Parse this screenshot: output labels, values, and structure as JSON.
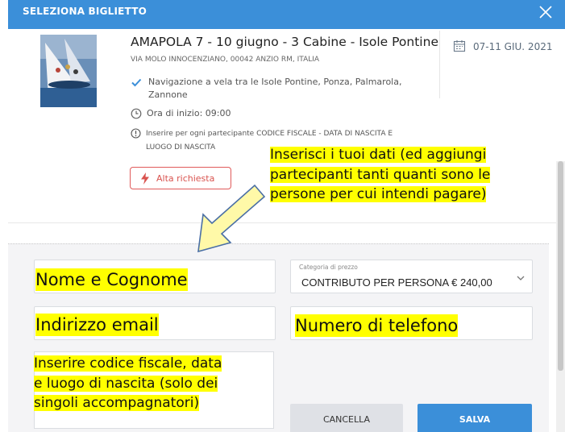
{
  "header": {
    "title": "SELEZIONA BIGLIETTO"
  },
  "event": {
    "title": "AMAPOLA 7 - 10 giugno - 3 Cabine - Isole Pontine",
    "address": "VIA MOLO INNOCENZIANO, 00042 ANZIO RM, ITALIA",
    "description_line1": "Navigazione a vela tra le Isole Pontine, Ponza, Palmarola,",
    "description_line2": "Zannone",
    "start_time": "Ora di inizio: 09:00",
    "notice_line1": "Inserire per ogni partecipante CODICE FISCALE - DATA DI NASCITA E",
    "notice_line2": "LUOGO DI NASCITA",
    "date": "07-11 GIU. 2021",
    "badge": "Alta richiesta"
  },
  "annotation": {
    "line1": "Inserisci i tuoi dati (ed aggiungi",
    "line2": "partecipanti tanti quanti sono le",
    "line3": "persone per cui intendi pagare)"
  },
  "form": {
    "name_field": "Nome e Cognome",
    "email_field": "Indirizzo email",
    "phone_field": "Numero di telefono",
    "price_category_label": "Categoria di prezzo",
    "price_category_value": "CONTRIBUTO PER PERSONA € 240,00",
    "notes_line1": "Inserire codice fiscale, data",
    "notes_line2": "e luogo di nascita (solo dei",
    "notes_line3": "singoli accompagnatori)"
  },
  "buttons": {
    "cancel": "CANCELLA",
    "save": "SALVA"
  },
  "colors": {
    "primary": "#3b8fd9",
    "highlight": "#ffff00",
    "badge_red": "#d9534f"
  },
  "icons": [
    "close-icon",
    "calendar-icon",
    "check-icon",
    "clock-icon",
    "info-icon",
    "lightning-icon",
    "chevron-down-icon",
    "arrow-icon"
  ]
}
